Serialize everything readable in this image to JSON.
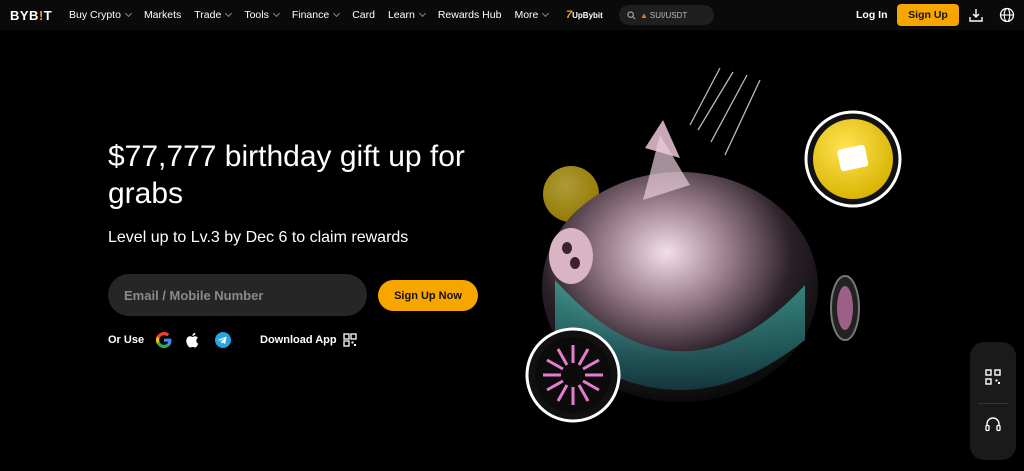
{
  "nav": {
    "logo": {
      "text_start": "BYB",
      "text_accent": "!",
      "text_end": "T"
    },
    "items": [
      {
        "label": "Buy Crypto",
        "dropdown": true
      },
      {
        "label": "Markets",
        "dropdown": false
      },
      {
        "label": "Trade",
        "dropdown": true
      },
      {
        "label": "Tools",
        "dropdown": true
      },
      {
        "label": "Finance",
        "dropdown": true
      },
      {
        "label": "Card",
        "dropdown": false
      },
      {
        "label": "Learn",
        "dropdown": true
      },
      {
        "label": "Rewards Hub",
        "dropdown": false
      },
      {
        "label": "More",
        "dropdown": true
      }
    ],
    "promo": {
      "seven": "7",
      "label": "UpBybit"
    },
    "search": {
      "placeholder": "SUI/USDT"
    },
    "login_label": "Log In",
    "signup_label": "Sign Up"
  },
  "hero": {
    "title": "$77,777 birthday gift up for grabs",
    "subtitle": "Level up to Lv.3 by Dec 6 to claim rewards",
    "email_placeholder": "Email / Mobile Number",
    "cta_label": "Sign Up Now",
    "or_use_label": "Or Use",
    "download_label": "Download App"
  },
  "colors": {
    "accent": "#f7a600",
    "background": "#000000",
    "input_bg": "#262626"
  }
}
